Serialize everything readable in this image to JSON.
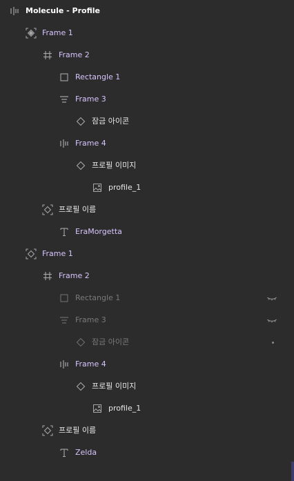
{
  "layers": {
    "root": {
      "label": "Molecule - Profile",
      "icon": "horizontal-bars-icon"
    },
    "items": [
      {
        "label": "Frame 1",
        "icon": "component-frame-icon"
      },
      {
        "label": "Frame 2",
        "icon": "frame-hash-icon"
      },
      {
        "label": "Rectangle 1",
        "icon": "rectangle-icon"
      },
      {
        "label": "Frame 3",
        "icon": "vertical-stack-icon"
      },
      {
        "label": "잠금 아이콘",
        "icon": "instance-icon"
      },
      {
        "label": "Frame 4",
        "icon": "horizontal-bars-icon"
      },
      {
        "label": "프로필 이미지",
        "icon": "instance-icon"
      },
      {
        "label": "profile_1",
        "icon": "image-icon"
      },
      {
        "label": "프로필 이름",
        "icon": "component-frame-icon"
      },
      {
        "label": "EraMorgetta",
        "icon": "text-icon"
      },
      {
        "label": "Frame 1",
        "icon": "component-frame-icon"
      },
      {
        "label": "Frame 2",
        "icon": "frame-hash-icon"
      },
      {
        "label": "Rectangle 1",
        "icon": "rectangle-icon",
        "hidden": true
      },
      {
        "label": "Frame 3",
        "icon": "vertical-stack-icon",
        "hidden": true
      },
      {
        "label": "잠금 아이콘",
        "icon": "instance-icon",
        "hidden": true
      },
      {
        "label": "Frame 4",
        "icon": "horizontal-bars-icon"
      },
      {
        "label": "프로필 이미지",
        "icon": "instance-icon"
      },
      {
        "label": "profile_1",
        "icon": "image-icon"
      },
      {
        "label": "프로필 이름",
        "icon": "component-frame-icon"
      },
      {
        "label": "Zelda",
        "icon": "text-icon"
      }
    ]
  },
  "colors": {
    "background": "#2c2c2c",
    "component_label": "#d9c6ff",
    "dim_label": "#7a7a7a",
    "icon": "#a8a8a8"
  }
}
